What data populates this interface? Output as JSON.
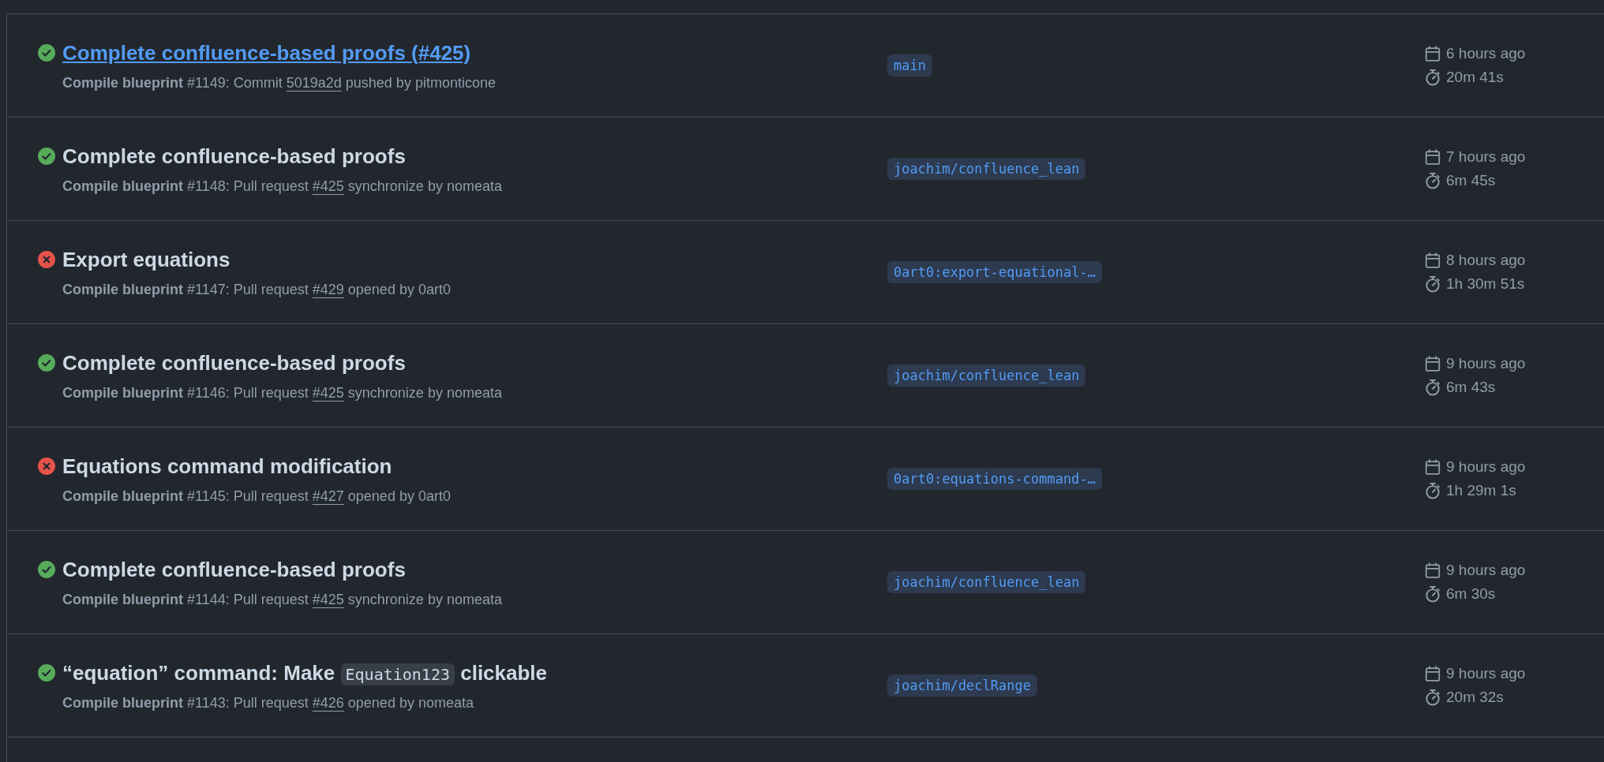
{
  "runs": [
    {
      "kind": "success",
      "hovered": true,
      "title": [
        {
          "kind": "text",
          "text": "Complete confluence-based proofs (#425)"
        }
      ],
      "workflow": "Compile blueprint",
      "event_prefix": "#1149: Commit",
      "ref": "5019a2d",
      "event_suffix": "pushed by pitmonticone",
      "branch": "main",
      "when": "6 hours ago",
      "duration": "20m 41s"
    },
    {
      "kind": "success",
      "hovered": false,
      "title": [
        {
          "kind": "text",
          "text": "Complete confluence-based proofs"
        }
      ],
      "workflow": "Compile blueprint",
      "event_prefix": "#1148: Pull request",
      "ref": "#425",
      "event_suffix": "synchronize by nomeata",
      "branch": "joachim/confluence_lean",
      "when": "7 hours ago",
      "duration": "6m 45s"
    },
    {
      "kind": "failure",
      "hovered": false,
      "title": [
        {
          "kind": "text",
          "text": "Export equations"
        }
      ],
      "workflow": "Compile blueprint",
      "event_prefix": "#1147: Pull request",
      "ref": "#429",
      "event_suffix": "opened by 0art0",
      "branch": "0art0:export-equational-…",
      "when": "8 hours ago",
      "duration": "1h 30m 51s"
    },
    {
      "kind": "success",
      "hovered": false,
      "title": [
        {
          "kind": "text",
          "text": "Complete confluence-based proofs"
        }
      ],
      "workflow": "Compile blueprint",
      "event_prefix": "#1146: Pull request",
      "ref": "#425",
      "event_suffix": "synchronize by nomeata",
      "branch": "joachim/confluence_lean",
      "when": "9 hours ago",
      "duration": "6m 43s"
    },
    {
      "kind": "failure",
      "hovered": false,
      "title": [
        {
          "kind": "text",
          "text": "Equations command modification"
        }
      ],
      "workflow": "Compile blueprint",
      "event_prefix": "#1145: Pull request",
      "ref": "#427",
      "event_suffix": "opened by 0art0",
      "branch": "0art0:equations-command-…",
      "when": "9 hours ago",
      "duration": "1h 29m 1s"
    },
    {
      "kind": "success",
      "hovered": false,
      "title": [
        {
          "kind": "text",
          "text": "Complete confluence-based proofs"
        }
      ],
      "workflow": "Compile blueprint",
      "event_prefix": "#1144: Pull request",
      "ref": "#425",
      "event_suffix": "synchronize by nomeata",
      "branch": "joachim/confluence_lean",
      "when": "9 hours ago",
      "duration": "6m 30s"
    },
    {
      "kind": "success",
      "hovered": false,
      "title": [
        {
          "kind": "text",
          "text": "“equation” command: Make"
        },
        {
          "kind": "code",
          "text": "Equation123"
        },
        {
          "kind": "text",
          "text": "clickable"
        }
      ],
      "workflow": "Compile blueprint",
      "event_prefix": "#1143: Pull request",
      "ref": "#426",
      "event_suffix": "opened by nomeata",
      "branch": "joachim/declRange",
      "when": "9 hours ago",
      "duration": "20m 32s"
    }
  ]
}
